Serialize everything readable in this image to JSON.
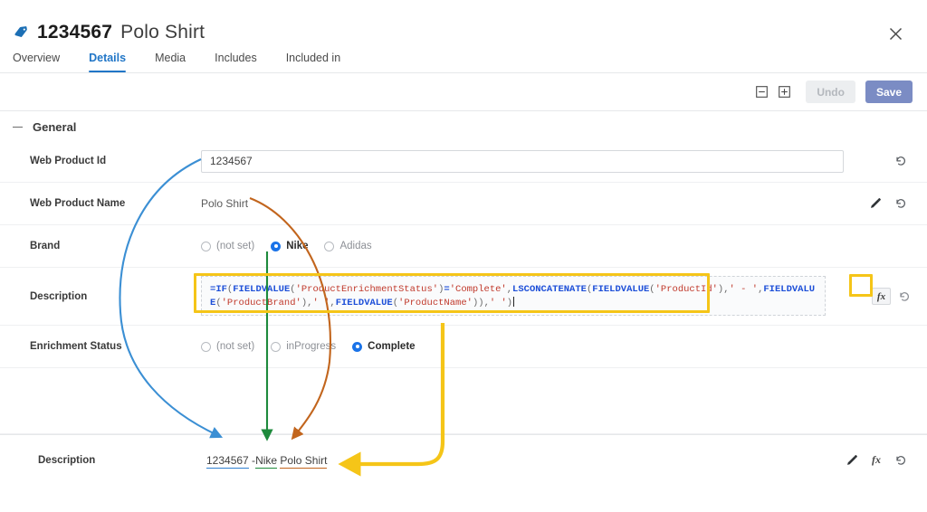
{
  "header": {
    "tag_icon": "tag-icon",
    "product_id": "1234567",
    "product_name": "Polo Shirt",
    "close_icon": "close-icon",
    "tabs": [
      {
        "label": "Overview",
        "active": false
      },
      {
        "label": "Details",
        "active": true
      },
      {
        "label": "Media",
        "active": false
      },
      {
        "label": "Includes",
        "active": false
      },
      {
        "label": "Included in",
        "active": false
      }
    ]
  },
  "toolbar": {
    "collapse_all_icon": "collapse-all-icon",
    "expand_all_icon": "expand-all-icon",
    "undo_label": "Undo",
    "save_label": "Save",
    "undo_disabled": true
  },
  "section": {
    "collapse_icon": "minus-icon",
    "title": "General"
  },
  "fields": {
    "web_product_id": {
      "label": "Web Product Id",
      "value": "1234567",
      "revert_icon": "revert-icon"
    },
    "web_product_name": {
      "label": "Web Product Name",
      "value": "Polo Shirt",
      "edit_icon": "pencil-icon",
      "revert_icon": "revert-icon"
    },
    "brand": {
      "label": "Brand",
      "options": [
        {
          "label": "(not set)",
          "selected": false
        },
        {
          "label": "Nike",
          "selected": true
        },
        {
          "label": "Adidas",
          "selected": false
        }
      ]
    },
    "description": {
      "label": "Description",
      "formula": {
        "op_equals": "=",
        "fn_if": "IF",
        "open1": "(",
        "fn_fieldvalue_1": "FIELDVALUE",
        "open2": "(",
        "str_enrichment": "'ProductEnrichmentStatus'",
        "close1": ")",
        "eq": "=",
        "str_complete": "'Complete'",
        "comma1": ",",
        "fn_concat": "LSCONCATENATE",
        "open3": "(",
        "fn_fieldvalue_2": "FIELDVALUE",
        "open4": "(",
        "str_productid": "'ProductId'",
        "close2": ")",
        "comma2": ",",
        "str_dash": "' - '",
        "comma3": ",",
        "fn_fieldvalue_3": "FIELDVALUE",
        "open5": "(",
        "str_productbrand": "'ProductBrand'",
        "close3": ")",
        "comma4": ",",
        "str_space": "' '",
        "comma5": ",",
        "fn_fieldvalue_4": "FIELDVALUE",
        "open6": "(",
        "str_productname": "'ProductName'",
        "close4": ")",
        "close5": ")",
        "comma6": ",",
        "str_blank": "' '",
        "close6": ")"
      },
      "full_text": "=IF(FIELDVALUE('ProductEnrichmentStatus')='Complete',LSCONCATENATE(FIELDVALUE('ProductId'),' - ',FIELDVALUE('ProductBrand'),' ',FIELDVALUE('ProductName')),' ')",
      "fx_label": "fx",
      "fx_icon": "formula-icon",
      "revert_icon": "revert-icon"
    },
    "enrichment_status": {
      "label": "Enrichment Status",
      "options": [
        {
          "label": "(not set)",
          "selected": false
        },
        {
          "label": "inProgress",
          "selected": false
        },
        {
          "label": "Complete",
          "selected": true
        }
      ]
    }
  },
  "result": {
    "label": "Description",
    "part_id": "1234567",
    "part_sep": " -",
    "part_brand": "Nike",
    "part_space": " ",
    "part_name": "Polo Shirt",
    "edit_icon": "pencil-icon",
    "fx_label": "fx",
    "revert_icon": "revert-icon"
  },
  "annotations": {
    "arrow_id_color": "#3b8fd4",
    "arrow_brand_color": "#1e8a3c",
    "arrow_name_color": "#c2651d",
    "arrow_formula_color": "#f5c518",
    "highlight_color": "#f5c518"
  }
}
